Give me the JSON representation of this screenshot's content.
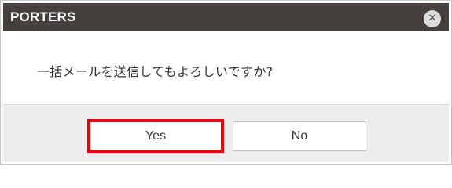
{
  "dialog": {
    "title": "PORTERS",
    "close_icon": "close-icon",
    "message": "一括メールを送信してもよろしいですか?",
    "buttons": {
      "yes_label": "Yes",
      "no_label": "No"
    }
  },
  "colors": {
    "titlebar": "#45403d",
    "highlight": "#e30613",
    "footer": "#ededed"
  }
}
